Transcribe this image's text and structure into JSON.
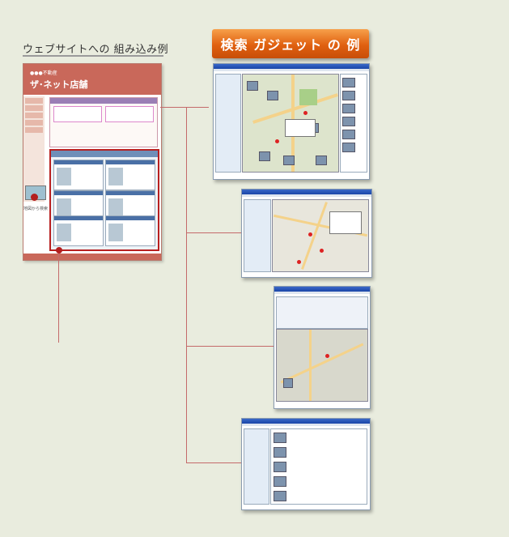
{
  "embed_label": "ウェブサイトへの 組み込み例",
  "banner_title": "検索 ガジェット の 例",
  "site": {
    "company": "●●●不動産",
    "store": "ザ･ネット店舗",
    "map_caption": "地図から検索"
  },
  "colors": {
    "background": "#e9ecde",
    "banner": "#e06010",
    "site_header": "#c9685a",
    "highlight": "#b82020",
    "connector": "#c46a6a"
  },
  "windows": [
    {
      "name": "map-photo-gadget",
      "view": "map-with-photos"
    },
    {
      "name": "map-gadget",
      "view": "map-with-pins"
    },
    {
      "name": "city-map-gadget",
      "view": "map-with-filters"
    },
    {
      "name": "list-gadget",
      "view": "property-list"
    }
  ]
}
